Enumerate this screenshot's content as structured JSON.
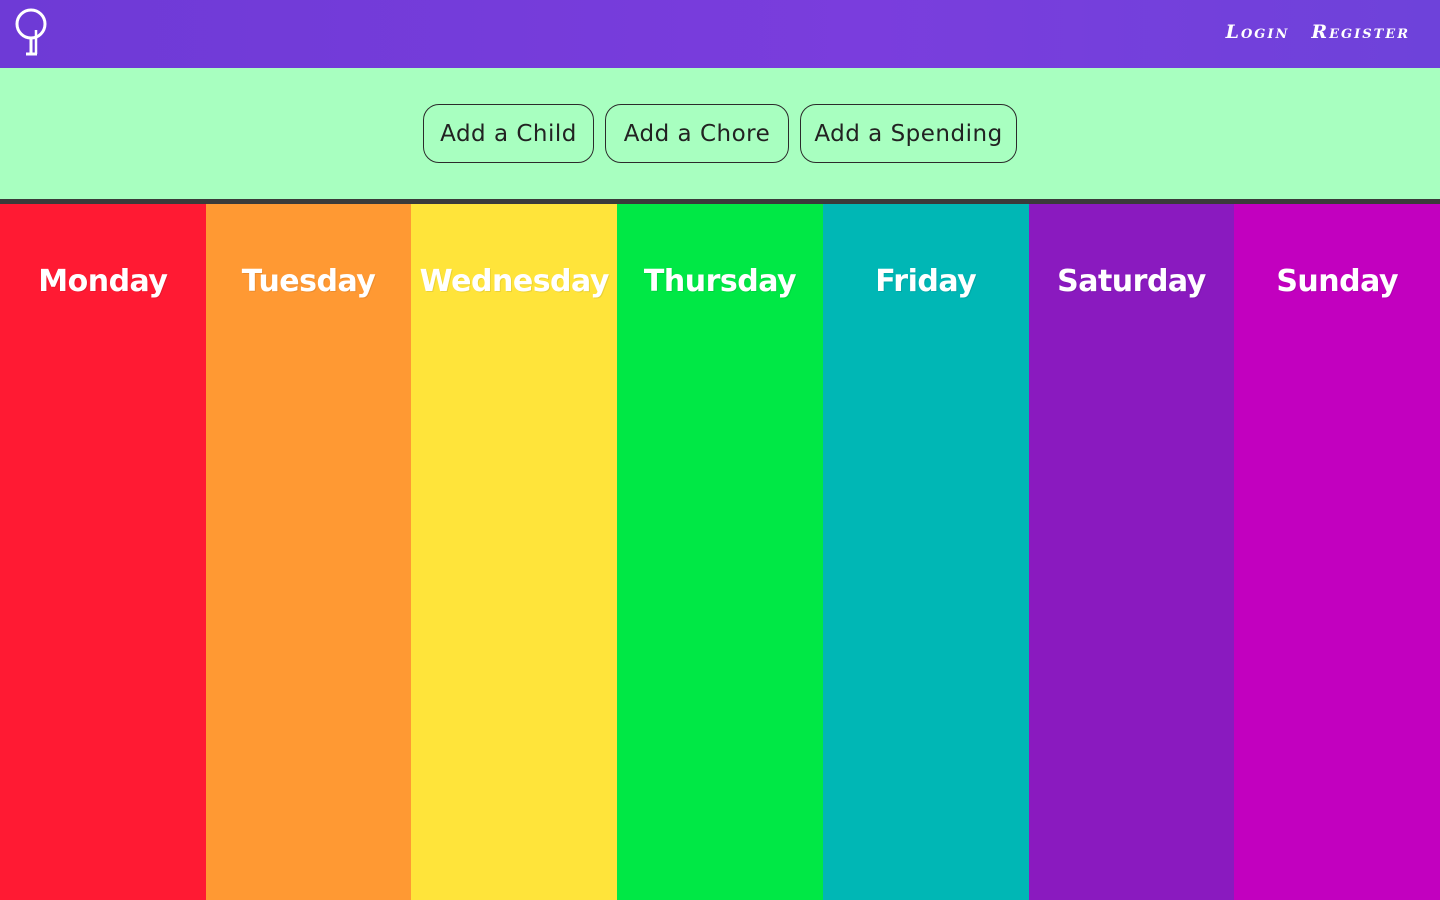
{
  "header": {
    "logo_icon": "stick-figure-logo-icon",
    "links": {
      "login": "Login",
      "register": "Register"
    }
  },
  "actions": {
    "add_child": "Add a Child",
    "add_chore": "Add a Chore",
    "add_spending": "Add a Spending"
  },
  "colors": {
    "nav": "#733ddb",
    "actions_bg": "#a8ffc0",
    "monday": "#ff1a33",
    "tuesday": "#ff9933",
    "wednesday": "#ffe43a",
    "thursday": "#00e845",
    "friday": "#00b7b5",
    "saturday": "#8a1abf",
    "sunday": "#c200bf"
  },
  "days": [
    {
      "label": "Monday"
    },
    {
      "label": "Tuesday"
    },
    {
      "label": "Wednesday"
    },
    {
      "label": "Thursday"
    },
    {
      "label": "Friday"
    },
    {
      "label": "Saturday"
    },
    {
      "label": "Sunday"
    }
  ]
}
